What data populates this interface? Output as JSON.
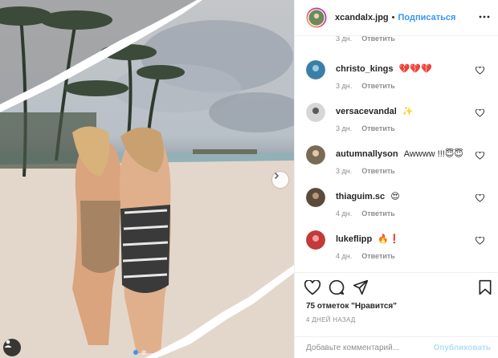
{
  "post": {
    "photo_alt_name": "beach-photo",
    "slide_count": 2,
    "active_slide": 1
  },
  "header": {
    "username": "xcandalx.jpg",
    "separator": "•",
    "follow_label": "Подписаться"
  },
  "cut_comment_meta": {
    "time": "3 дн.",
    "reply": "Ответить"
  },
  "comments": [
    {
      "user": "christo_kings",
      "text": "💔💔💔",
      "time": "3 дн.",
      "reply": "Ответить",
      "avatar_color": "#3a7fa8"
    },
    {
      "user": "versacevandal",
      "text": "✨",
      "time": "3 дн.",
      "reply": "Ответить",
      "avatar_color": "#c9c9c9"
    },
    {
      "user": "autumnallyson",
      "text": "Awwww !!!😇😇",
      "time": "3 дн.",
      "reply": "Ответить",
      "avatar_color": "#7a6a55"
    },
    {
      "user": "thiaguim.sc",
      "text": "😍",
      "time": "4 дн.",
      "reply": "Ответить",
      "avatar_color": "#5a4a3a"
    },
    {
      "user": "lukeflipp",
      "text": "🔥❗",
      "time": "4 дн.",
      "reply": "Ответить",
      "avatar_color": "#c23a3a"
    }
  ],
  "actions": {
    "likes": "75 отметок \"Нравится\"",
    "date": "4 ДНЕЙ НАЗАД"
  },
  "add_comment": {
    "placeholder": "Добавьте комментарий...",
    "publish_label": "Опубликовать"
  },
  "colors": {
    "accent": "#3897f0",
    "publish_disabled": "#b2dffc",
    "meta": "#8e8e8e"
  }
}
